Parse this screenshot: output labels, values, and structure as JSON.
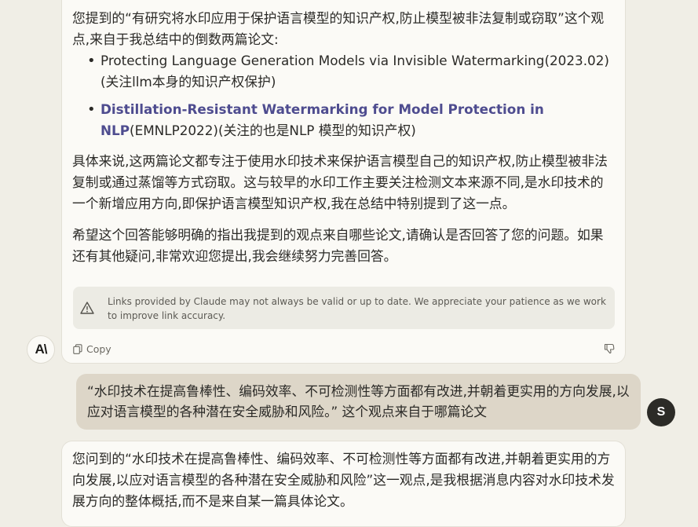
{
  "assistant_message_1": {
    "para1": "您提到的“有研究将水印应用于保护语言模型的知识产权,防止模型被非法复制或窃取”这个观点,来自于我总结中的倒数两篇论文:",
    "items": [
      {
        "plain": "Protecting Language Generation Models via Invisible Watermarking(2023.02)(关注llm本身的知识产权保护)"
      },
      {
        "link": "Distillation-Resistant Watermarking for Model Protection in NLP",
        "rest": "(EMNLP2022)(关注的也是NLP 模型的知识产权)"
      }
    ],
    "para2": "具体来说,这两篇论文都专注于使用水印技术来保护语言模型自己的知识产权,防止模型被非法复制或通过蒸馏等方式窃取。这与较早的水印工作主要关注检测文本来源不同,是水印技术的一个新增应用方向,即保护语言模型知识产权,我在总结中特别提到了这一点。",
    "para3": "希望这个回答能够明确的指出我提到的观点来自哪些论文,请确认是否回答了您的问题。如果还有其他疑问,非常欢迎您提出,我会继续努力完善回答。",
    "notice": "Links provided by Claude may not always be valid or up to date. We appreciate your patience as we work to improve link accuracy.",
    "copy_label": "Copy"
  },
  "claude_avatar": {
    "text": "A\\"
  },
  "user_message": {
    "text": "“水印技术在提高鲁棒性、编码效率、不可检测性等方面都有改进,并朝着更实用的方向发展,以应对语言模型的各种潜在安全威胁和风险。” 这个观点来自于哪篇论文",
    "avatar_letter": "S"
  },
  "assistant_message_2": {
    "para1": "您问到的“水印技术在提高鲁棒性、编码效率、不可检测性等方面都有改进,并朝着更实用的方向发展,以应对语言模型的各种潜在安全威胁和风险”这一观点,是我根据消息内容对水印技术发展方向的整体概括,而不是来自某一篇具体论文。"
  },
  "colors": {
    "background": "#f0eee6",
    "card": "#fbfaf6",
    "user_bubble": "#ddd6c8",
    "link": "#4e4c8f",
    "user_avatar": "#2c2b27"
  }
}
